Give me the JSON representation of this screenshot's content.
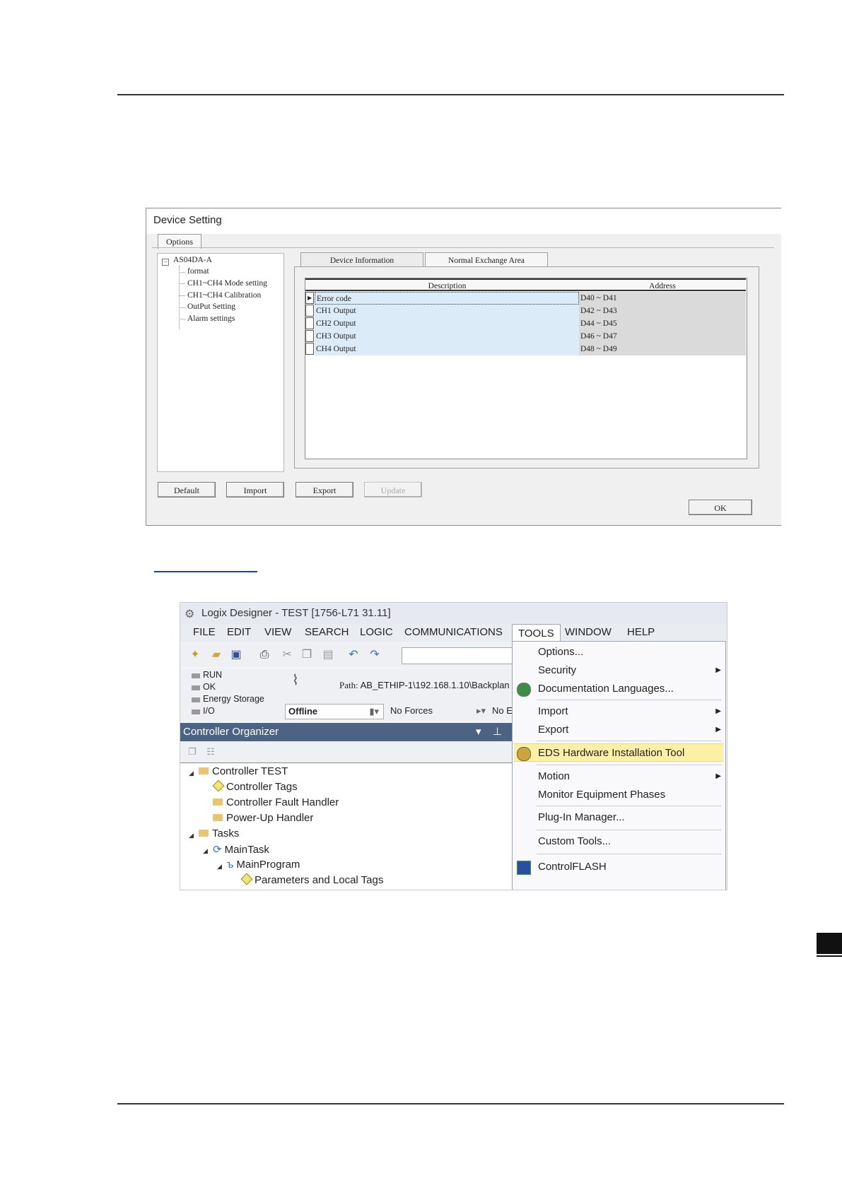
{
  "device_setting": {
    "title": "Device Setting",
    "options_tab": "Options",
    "tree": {
      "root": "AS04DA-A",
      "children": [
        "format",
        "CH1~CH4 Mode setting",
        "CH1~CH4 Calibration",
        "OutPut Setting",
        "Alarm settings"
      ]
    },
    "tabs": [
      "Device Information",
      "Normal Exchange Area"
    ],
    "grid": {
      "headers": [
        "Description",
        "Address"
      ],
      "rows": [
        {
          "description": "Error code",
          "address": "D40 ~ D41"
        },
        {
          "description": "CH1 Output",
          "address": "D42 ~ D43"
        },
        {
          "description": "CH2 Output",
          "address": "D44 ~ D45"
        },
        {
          "description": "CH3 Output",
          "address": "D46 ~ D47"
        },
        {
          "description": "CH4 Output",
          "address": "D48 ~ D49"
        }
      ]
    },
    "buttons": {
      "default": "Default",
      "import": "Import",
      "export": "Export",
      "update": "Update",
      "ok": "OK"
    }
  },
  "logix": {
    "title": "Logix Designer - TEST [1756-L71 31.11]",
    "menu": [
      "FILE",
      "EDIT",
      "VIEW",
      "SEARCH",
      "LOGIC",
      "COMMUNICATIONS",
      "TOOLS",
      "WINDOW",
      "HELP"
    ],
    "status_labels": [
      "RUN",
      "OK",
      "Energy Storage",
      "I/O"
    ],
    "path_label": "Path:",
    "path_value": "AB_ETHIP-1\\192.168.1.10\\Backplan",
    "mode": "Offline",
    "forces": "No Forces",
    "extra": "No E",
    "organizer_title": "Controller Organizer",
    "tree": {
      "controller": "Controller TEST",
      "controller_tags": "Controller Tags",
      "fault_handler": "Controller Fault Handler",
      "powerup_handler": "Power-Up Handler",
      "tasks": "Tasks",
      "main_task": "MainTask",
      "main_program": "MainProgram",
      "params": "Parameters and Local Tags"
    },
    "tools_menu": {
      "options": "Options...",
      "security": "Security",
      "doc_languages": "Documentation Languages...",
      "import": "Import",
      "export": "Export",
      "eds_tool": "EDS Hardware Installation Tool",
      "motion": "Motion",
      "monitor_phases": "Monitor Equipment Phases",
      "plugin_manager": "Plug-In Manager...",
      "custom_tools": "Custom Tools...",
      "controlflash": "ControlFLASH"
    }
  }
}
